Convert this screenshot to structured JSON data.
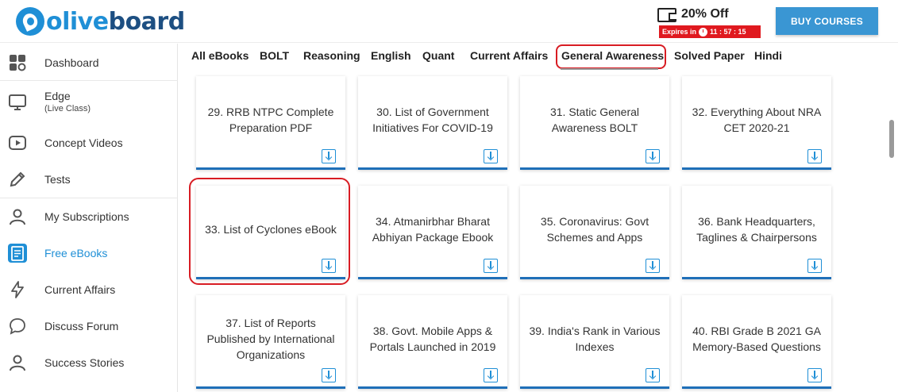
{
  "header": {
    "logo_prefix": "olive",
    "logo_suffix": "board",
    "offer_text": "20% Off",
    "expires_label": "Expires in",
    "expires_timer": "11 : 57 : 15",
    "buy_label": "BUY COURSES"
  },
  "sidebar": {
    "items": [
      {
        "label": "Dashboard",
        "icon": "dashboard-icon"
      },
      {
        "label": "Edge",
        "sublabel": "(Live Class)",
        "icon": "monitor-icon"
      },
      {
        "label": "Concept Videos",
        "icon": "video-icon"
      },
      {
        "label": "Tests",
        "icon": "pencil-icon"
      },
      {
        "label": "My Subscriptions",
        "icon": "user-icon"
      },
      {
        "label": "Free eBooks",
        "icon": "ebook-icon"
      },
      {
        "label": "Current Affairs",
        "icon": "lightning-icon"
      },
      {
        "label": "Discuss Forum",
        "icon": "chat-icon"
      },
      {
        "label": "Success Stories",
        "icon": "user-icon"
      }
    ],
    "active_color": "#1f8fd6"
  },
  "tabs": [
    "All eBooks",
    "BOLT",
    "Reasoning",
    "English",
    "Quant",
    "Current Affairs",
    "General Awareness",
    "Solved Paper",
    "Hindi"
  ],
  "active_tab": "General Awareness",
  "cards": [
    {
      "title": "29.  RRB NTPC Complete Preparation PDF"
    },
    {
      "title": "30.  List of Government Initiatives For COVID-19"
    },
    {
      "title": "31.  Static General Awareness BOLT"
    },
    {
      "title": "32.  Everything About NRA CET 2020-21"
    },
    {
      "title": "33.  List of Cyclones eBook"
    },
    {
      "title": "34.  Atmanirbhar Bharat Abhiyan Package Ebook"
    },
    {
      "title": "35.  Coronavirus: Govt Schemes and Apps"
    },
    {
      "title": "36.  Bank Headquarters, Taglines & Chairpersons"
    },
    {
      "title": "37.  List of Reports Published by International Organizations"
    },
    {
      "title": "38.  Govt. Mobile Apps & Portals Launched in 2019"
    },
    {
      "title": "39.  India's Rank in Various Indexes"
    },
    {
      "title": "40.  RBI Grade B 2021 GA Memory-Based Questions"
    }
  ],
  "colors": {
    "brand": "#1f8fd6",
    "highlight": "#d81c23",
    "buy_button": "#3a96d3"
  }
}
